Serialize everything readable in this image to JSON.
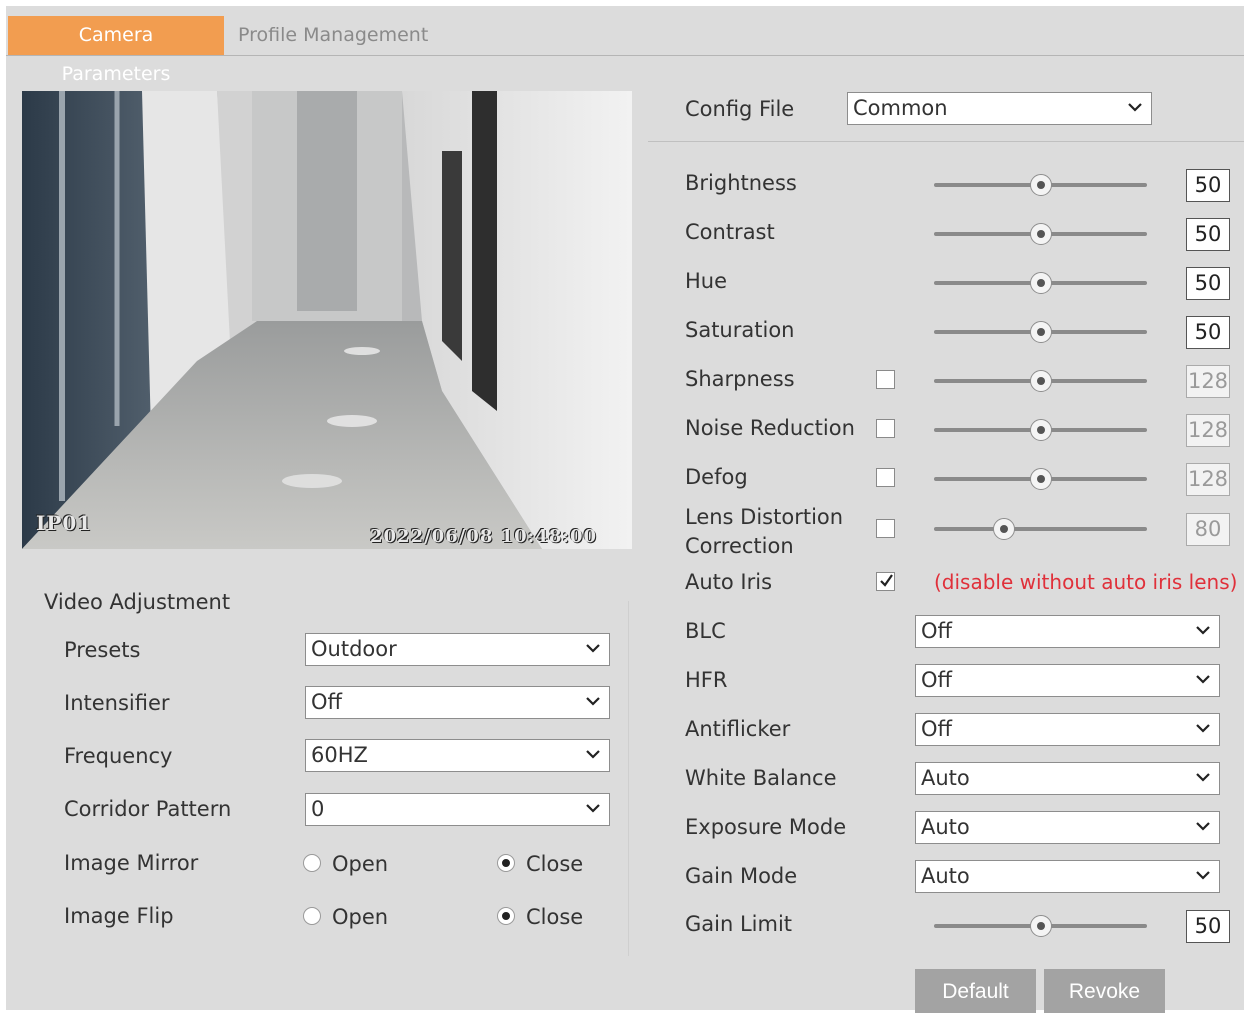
{
  "tabs": [
    {
      "label": "Camera Parameters",
      "active": true
    },
    {
      "label": "Profile Management",
      "active": false
    }
  ],
  "video": {
    "channel": "IP01",
    "timestamp": "2022/06/08 10:48:00"
  },
  "video_adjustment": {
    "title": "Video Adjustment",
    "presets": {
      "label": "Presets",
      "value": "Outdoor"
    },
    "intensifier": {
      "label": "Intensifier",
      "value": "Off"
    },
    "frequency": {
      "label": "Frequency",
      "value": "60HZ"
    },
    "corridor": {
      "label": "Corridor Pattern",
      "value": "0"
    },
    "mirror": {
      "label": "Image Mirror",
      "open": "Open",
      "close": "Close",
      "selected": "Close"
    },
    "flip": {
      "label": "Image Flip",
      "open": "Open",
      "close": "Close",
      "selected": "Close"
    }
  },
  "config_file": {
    "label": "Config File",
    "value": "Common"
  },
  "sliders": [
    {
      "label": "Brightness",
      "value": "50",
      "fraction": 0.5,
      "checkbox": false,
      "enabled": true
    },
    {
      "label": "Contrast",
      "value": "50",
      "fraction": 0.5,
      "checkbox": false,
      "enabled": true
    },
    {
      "label": "Hue",
      "value": "50",
      "fraction": 0.5,
      "checkbox": false,
      "enabled": true
    },
    {
      "label": "Saturation",
      "value": "50",
      "fraction": 0.5,
      "checkbox": false,
      "enabled": true
    },
    {
      "label": "Sharpness",
      "value": "128",
      "fraction": 0.5,
      "checkbox": true,
      "checked": false,
      "enabled": false
    },
    {
      "label": "Noise Reduction",
      "value": "128",
      "fraction": 0.5,
      "checkbox": true,
      "checked": false,
      "enabled": false
    },
    {
      "label": "Defog",
      "value": "128",
      "fraction": 0.5,
      "checkbox": true,
      "checked": false,
      "enabled": false
    }
  ],
  "lens_distortion": {
    "label_line1": "Lens Distortion",
    "label_line2": "Correction",
    "value": "80",
    "fraction": 0.33,
    "checked": false
  },
  "auto_iris": {
    "label": "Auto Iris",
    "checked": true,
    "note": "(disable without auto iris lens)"
  },
  "dropdowns": [
    {
      "label": "BLC",
      "value": "Off"
    },
    {
      "label": "HFR",
      "value": "Off"
    },
    {
      "label": "Antiflicker",
      "value": "Off"
    },
    {
      "label": "White Balance",
      "value": "Auto"
    },
    {
      "label": "Exposure Mode",
      "value": "Auto"
    },
    {
      "label": "Gain Mode",
      "value": "Auto"
    }
  ],
  "gain_limit": {
    "label": "Gain Limit",
    "value": "50",
    "fraction": 0.5
  },
  "buttons": {
    "default": "Default",
    "revoke": "Revoke"
  },
  "colors": {
    "accent": "#f29d50",
    "note": "#e0303a",
    "button": "#a3a3a3"
  }
}
